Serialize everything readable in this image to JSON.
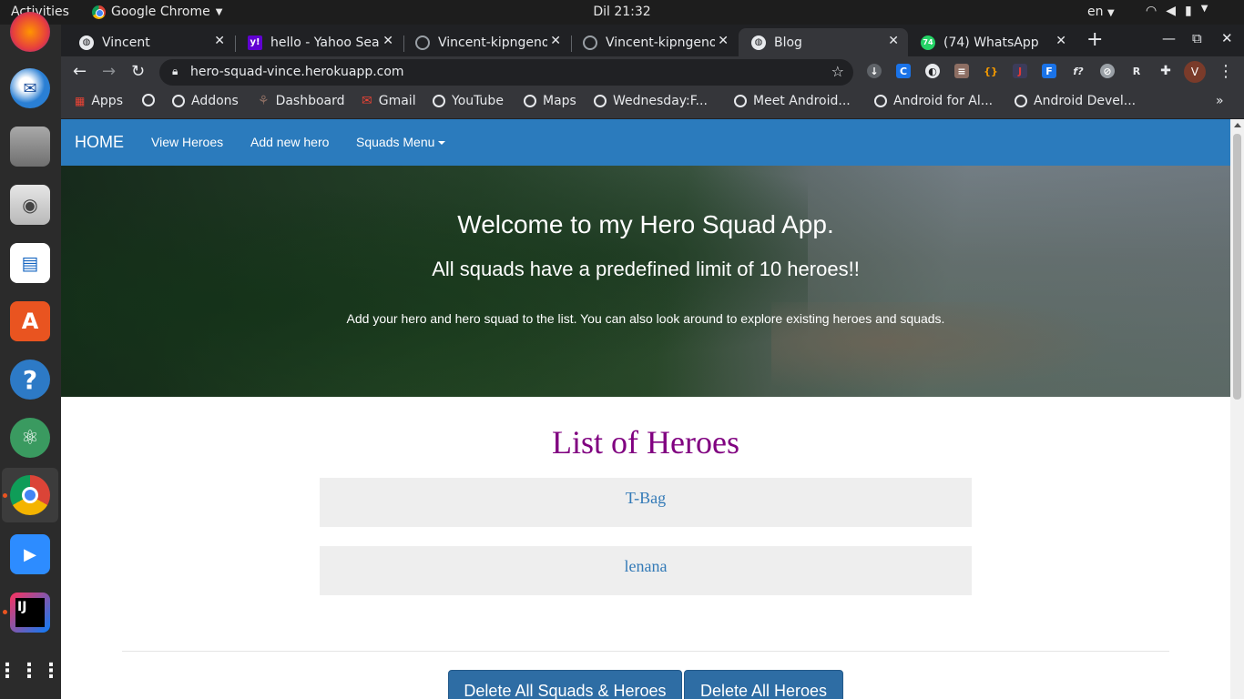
{
  "os": {
    "activities": "Activities",
    "app_name": "Google Chrome",
    "clock": "Dil 21:32",
    "language": "en"
  },
  "browser": {
    "tabs": [
      {
        "title": "Vincent",
        "icon": "globe-icon",
        "active": false
      },
      {
        "title": "hello - Yahoo Sear",
        "icon": "yahoo-icon",
        "active": false
      },
      {
        "title": "Vincent-kipngeno",
        "icon": "github-icon",
        "active": false
      },
      {
        "title": "Vincent-kipngeno",
        "icon": "github-icon",
        "active": false
      },
      {
        "title": "Blog",
        "icon": "globe-icon",
        "active": true
      },
      {
        "title": "(74) WhatsApp",
        "icon": "whatsapp-icon",
        "active": false
      }
    ],
    "url": "hero-squad-vince.herokuapp.com",
    "profile_initial": "V",
    "bookmarks": [
      "Apps",
      "",
      "Addons",
      "Dashboard",
      "Gmail",
      "YouTube",
      "Maps",
      "Wednesday:F...",
      "Meet Android...",
      "Android for Al...",
      "Android Devel..."
    ]
  },
  "page": {
    "navbar": {
      "brand": "HOME",
      "links": [
        "View Heroes",
        "Add new hero",
        "Squads Menu"
      ]
    },
    "hero": {
      "title": "Welcome to my Hero Squad App.",
      "subtitle": "All squads have a predefined limit of 10 heroes!!",
      "description": "Add your hero and hero squad to the list. You can also look around to explore existing heroes and squads."
    },
    "list_title": "List of Heroes",
    "heroes": [
      "T-Bag",
      "lenana"
    ],
    "buttons": {
      "delete_all": "Delete All Squads & Heroes",
      "delete_heroes": "Delete All Heroes"
    }
  }
}
